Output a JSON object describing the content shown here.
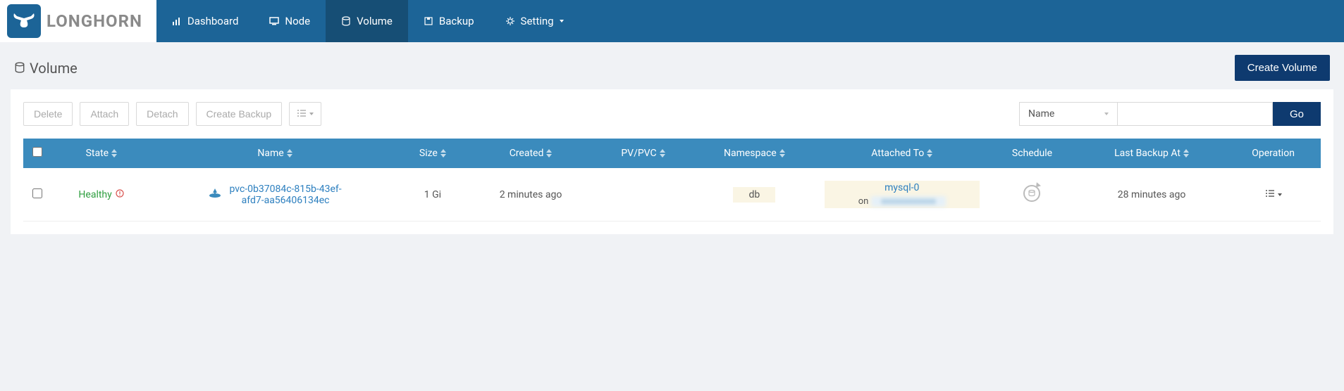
{
  "brand": "LONGHORN",
  "nav": {
    "dashboard": "Dashboard",
    "node": "Node",
    "volume": "Volume",
    "backup": "Backup",
    "setting": "Setting"
  },
  "page": {
    "title": "Volume",
    "createButton": "Create Volume"
  },
  "toolbar": {
    "delete": "Delete",
    "attach": "Attach",
    "detach": "Detach",
    "createBackup": "Create Backup",
    "filterField": "Name",
    "go": "Go"
  },
  "columns": {
    "state": "State",
    "name": "Name",
    "size": "Size",
    "created": "Created",
    "pvpvc": "PV/PVC",
    "namespace": "Namespace",
    "attachedTo": "Attached To",
    "schedule": "Schedule",
    "lastBackupAt": "Last Backup At",
    "operation": "Operation"
  },
  "row": {
    "state": "Healthy",
    "name": "pvc-0b37084c-815b-43ef-afd7-aa56406134ec",
    "size": "1 Gi",
    "created": "2 minutes ago",
    "pvpvc": "",
    "namespace": "db",
    "attachedWorkload": "mysql-0",
    "attachedOn": "on",
    "lastBackupAt": "28 minutes ago"
  }
}
